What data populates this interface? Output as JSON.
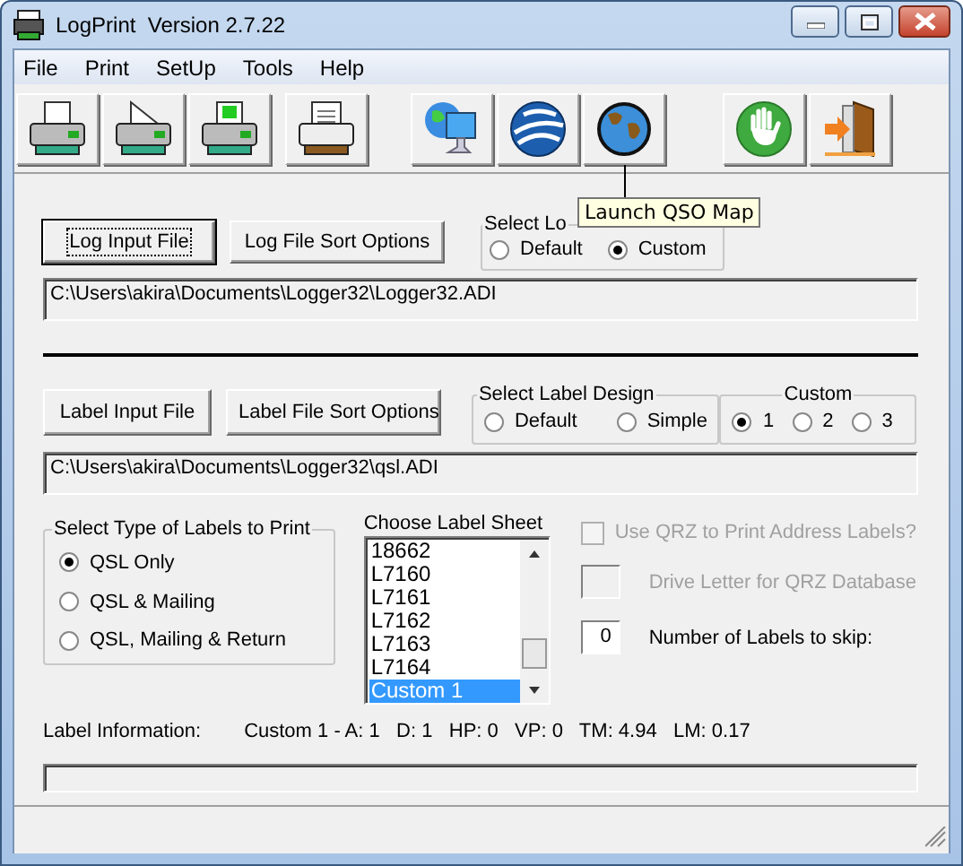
{
  "window": {
    "title": "LogPrint  Version 2.7.22"
  },
  "menu": [
    "File",
    "Print",
    "SetUp",
    "Tools",
    "Help"
  ],
  "toolbar": [
    [
      {
        "kind": "printer-blank"
      },
      {
        "kind": "printer-label"
      },
      {
        "kind": "printer-grid"
      }
    ],
    [
      {
        "kind": "printer-paper"
      }
    ],
    [
      {
        "kind": "network-globe"
      },
      {
        "kind": "earth-ball"
      },
      {
        "kind": "globe",
        "tooltip": "Launch QSO Map"
      }
    ],
    [
      {
        "kind": "stop-hand"
      },
      {
        "kind": "exit-door"
      }
    ]
  ],
  "log_input": {
    "buttons": [
      {
        "label": "Log Input File",
        "focused": true
      },
      {
        "label": "Log File Sort Options",
        "focused": false
      }
    ],
    "format_group": {
      "title": "Select Lo",
      "options": [
        {
          "label": "Default",
          "selected": false
        },
        {
          "label": "Custom",
          "selected": true
        }
      ]
    },
    "path": "C:\\Users\\akira\\Documents\\Logger32\\Logger32.ADI"
  },
  "label_input": {
    "buttons": [
      {
        "label": "Label Input File",
        "focused": false
      },
      {
        "label": "Label File Sort Options",
        "focused": false
      }
    ],
    "design_group": {
      "title": "Select Label Design",
      "options": [
        {
          "label": "Default",
          "selected": false
        },
        {
          "label": "Simple",
          "selected": false
        }
      ]
    },
    "custom_group": {
      "title": "Custom",
      "options": [
        {
          "label": "1",
          "selected": true
        },
        {
          "label": "2",
          "selected": false
        },
        {
          "label": "3",
          "selected": false
        }
      ]
    },
    "path": "C:\\Users\\akira\\Documents\\Logger32\\qsl.ADI"
  },
  "label_types": {
    "title": "Select Type of Labels to Print",
    "options": [
      {
        "label": "QSL Only",
        "selected": true
      },
      {
        "label": "QSL & Mailing",
        "selected": false
      },
      {
        "label": "QSL, Mailing & Return",
        "selected": false
      }
    ]
  },
  "label_sheet": {
    "title": "Choose Label Sheet",
    "items": [
      {
        "label": "18662",
        "selected": false
      },
      {
        "label": "L7160",
        "selected": false
      },
      {
        "label": "L7161",
        "selected": false
      },
      {
        "label": "L7162",
        "selected": false
      },
      {
        "label": "L7163",
        "selected": false
      },
      {
        "label": "L7164",
        "selected": false
      },
      {
        "label": "Custom 1",
        "selected": true
      }
    ]
  },
  "qrz": {
    "use_label": "Use QRZ to Print Address Labels?",
    "checked": false,
    "disabled": true,
    "drive_label": "Drive Letter for QRZ Database"
  },
  "skip": {
    "value": "0",
    "label": "Number of Labels to skip:"
  },
  "label_information": {
    "label": "Label Information:",
    "value": "Custom 1 - A: 1   D: 1   HP: 0   VP: 0   TM: 4.94   LM: 0.17"
  },
  "progress": {
    "level": 0
  }
}
